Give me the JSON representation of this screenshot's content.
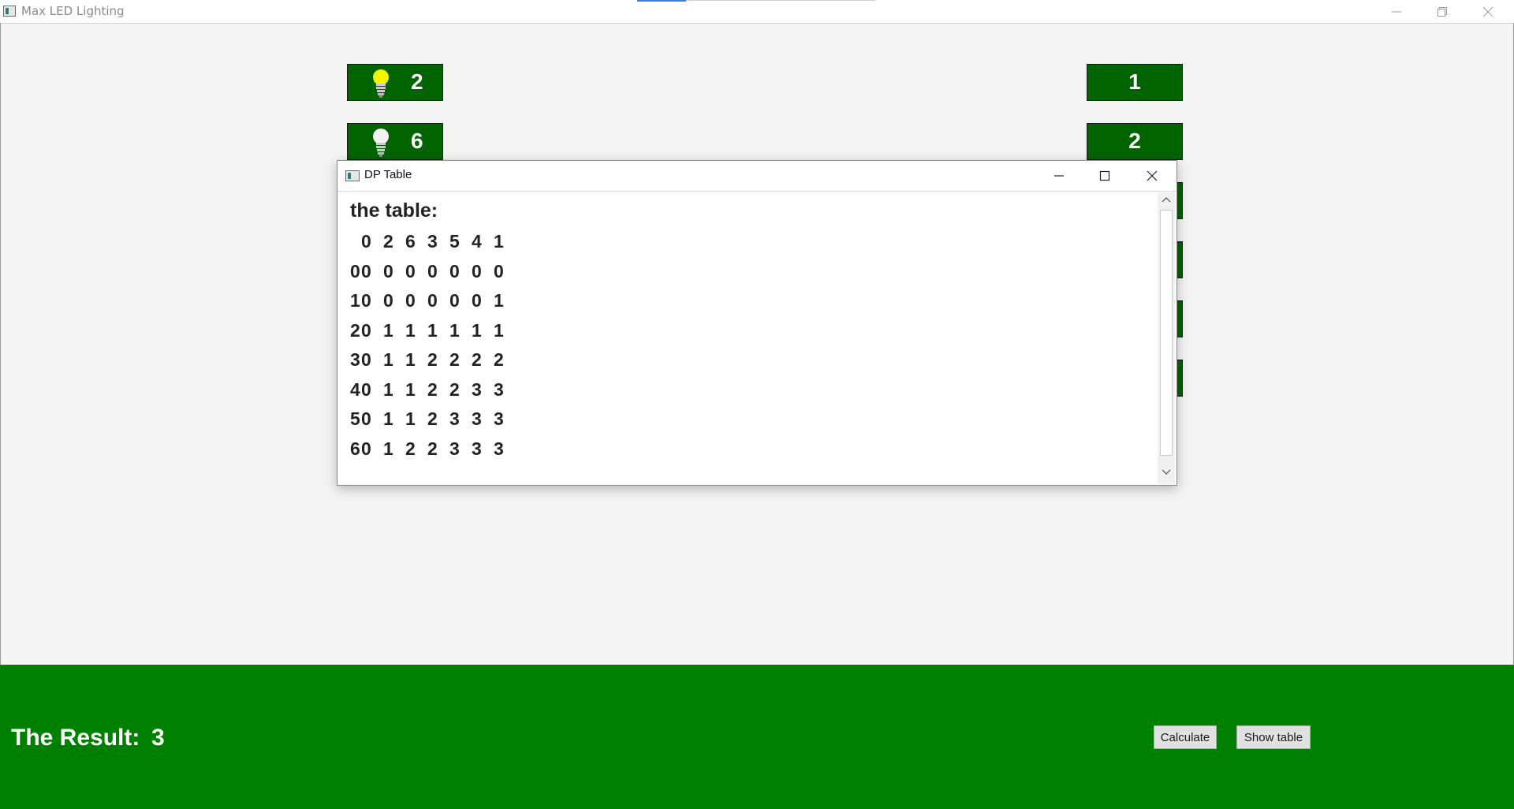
{
  "window": {
    "title": "Max LED Lighting"
  },
  "left_leds": [
    {
      "value": "2",
      "icon": "bulb-on-icon"
    },
    {
      "value": "6",
      "icon": "bulb-off-icon"
    }
  ],
  "right_leds": [
    {
      "value": "1"
    },
    {
      "value": "2"
    }
  ],
  "dialog": {
    "title": "DP Table",
    "heading": "the table:",
    "header_row": [
      "0",
      "2",
      "6",
      "3",
      "5",
      "4",
      "1"
    ],
    "rows": [
      [
        "0",
        "0",
        "0",
        "0",
        "0",
        "0",
        "0",
        "0"
      ],
      [
        "1",
        "0",
        "0",
        "0",
        "0",
        "0",
        "0",
        "1"
      ],
      [
        "2",
        "0",
        "1",
        "1",
        "1",
        "1",
        "1",
        "1"
      ],
      [
        "3",
        "0",
        "1",
        "1",
        "2",
        "2",
        "2",
        "2"
      ],
      [
        "4",
        "0",
        "1",
        "1",
        "2",
        "2",
        "3",
        "3"
      ],
      [
        "5",
        "0",
        "1",
        "1",
        "2",
        "3",
        "3",
        "3"
      ],
      [
        "6",
        "0",
        "1",
        "2",
        "2",
        "3",
        "3",
        "3"
      ]
    ]
  },
  "bottom": {
    "result_label": "The Result:",
    "result_value": "3",
    "calculate_label": "Calculate",
    "show_table_label": "Show table"
  },
  "colors": {
    "led_bg": "#006400",
    "panel_bg": "#008000",
    "bulb_on": "#f5f500"
  }
}
